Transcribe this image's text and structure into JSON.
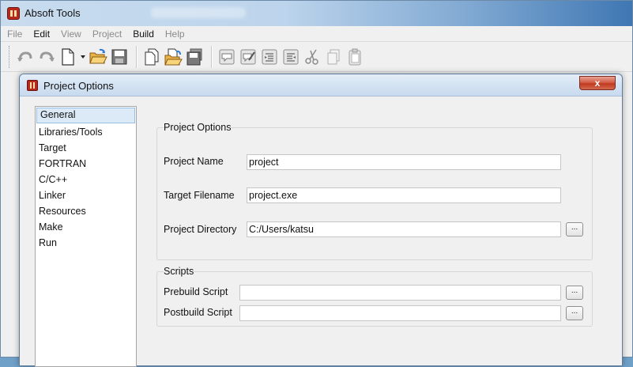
{
  "app": {
    "title": "Absoft Tools"
  },
  "menu": {
    "items": [
      {
        "label": "File",
        "enabled": false
      },
      {
        "label": "Edit",
        "enabled": true
      },
      {
        "label": "View",
        "enabled": false
      },
      {
        "label": "Project",
        "enabled": false
      },
      {
        "label": "Build",
        "enabled": true
      },
      {
        "label": "Help",
        "enabled": false
      }
    ]
  },
  "toolbar": {
    "icons": [
      "undo-icon",
      "redo-icon",
      "new-file-icon",
      "open-folder-icon",
      "save-icon",
      "new-project-icon",
      "open-project-icon",
      "save-project-icon",
      "comment-icon",
      "uncomment-icon",
      "indent-icon",
      "outdent-icon",
      "cut-icon",
      "copy-icon",
      "paste-icon"
    ]
  },
  "dialog": {
    "title": "Project Options",
    "close_label": "x",
    "categories": [
      "General",
      "Libraries/Tools",
      "Target",
      "FORTRAN",
      "C/C++",
      "Linker",
      "Resources",
      "Make",
      "Run"
    ],
    "selected_category": "General",
    "project_options": {
      "group_title": "Project Options",
      "project_name_label": "Project Name",
      "project_name_value": "project",
      "target_filename_label": "Target Filename",
      "target_filename_value": "project.exe",
      "project_directory_label": "Project Directory",
      "project_directory_value": "C:/Users/katsu",
      "browse_label": "..."
    },
    "scripts": {
      "group_title": "Scripts",
      "prebuild_label": "Prebuild Script",
      "prebuild_value": "",
      "postbuild_label": "Postbuild Script",
      "postbuild_value": "",
      "browse_label": "..."
    }
  }
}
